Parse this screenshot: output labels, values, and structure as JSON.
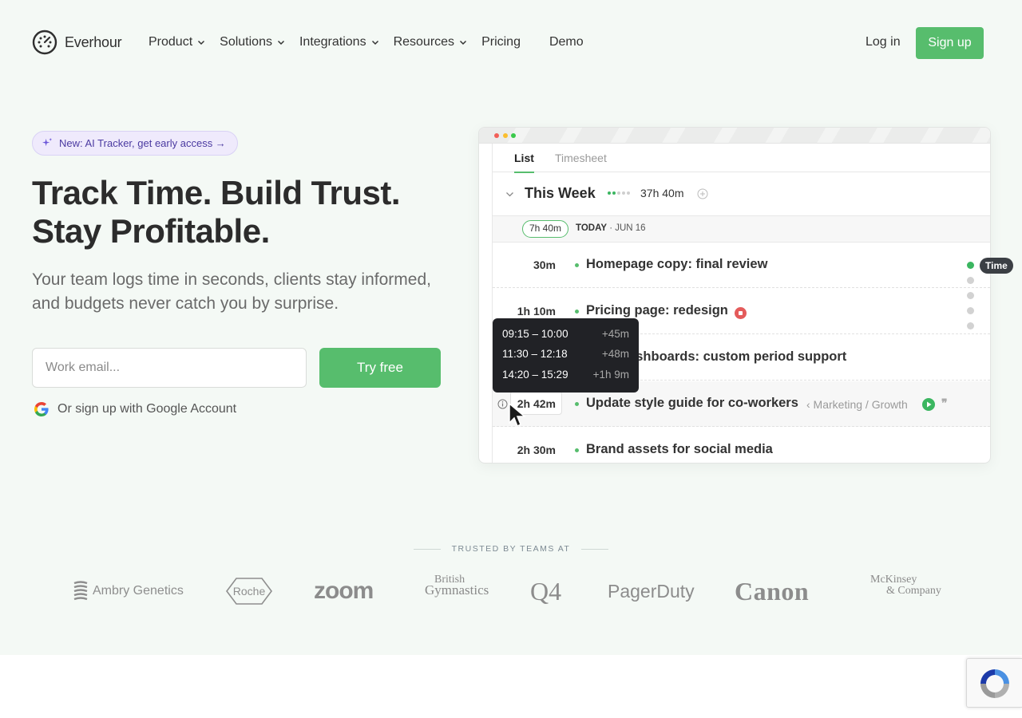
{
  "nav": {
    "brand": "Everhour",
    "items": [
      {
        "label": "Product",
        "dropdown": true
      },
      {
        "label": "Solutions",
        "dropdown": true
      },
      {
        "label": "Integrations",
        "dropdown": true
      },
      {
        "label": "Resources",
        "dropdown": true
      },
      {
        "label": "Pricing",
        "dropdown": false
      },
      {
        "label": "Demo",
        "dropdown": false
      }
    ],
    "login": "Log in",
    "signup": "Sign up"
  },
  "hero": {
    "badge": "New: AI Tracker, get early access →",
    "headline_line1": "Track Time. Build Trust.",
    "headline_line2": "Stay Profitable.",
    "subtitle": "Your team logs time in seconds, clients stay informed, and budgets never catch you by surprise.",
    "email_placeholder": "Work email...",
    "cta": "Try free",
    "google_signup": "Or sign up with Google Account"
  },
  "app": {
    "tabs": [
      {
        "label": "List",
        "active": true
      },
      {
        "label": "Timesheet",
        "active": false
      }
    ],
    "week_title": "This Week",
    "week_total": "37h 40m",
    "day_total": "7h 40m",
    "day_name": "TODAY",
    "day_date": "· JUN 16",
    "entries": [
      {
        "time": "30m",
        "title": "Homepage copy: final review"
      },
      {
        "time": "1h 10m",
        "title": "Pricing page: redesign",
        "running": true
      },
      {
        "time": "",
        "title": "dashboards: custom period support"
      },
      {
        "time": "2h 42m",
        "title": "Update style guide for co-workers",
        "path": "‹ Marketing / Growth"
      },
      {
        "time": "2h 30m",
        "title": "Brand assets for social media"
      }
    ],
    "tooltip": [
      {
        "range": "09:15 – 10:00",
        "delta": "+45m"
      },
      {
        "range": "11:30 – 12:18",
        "delta": "+48m"
      },
      {
        "range": "14:20 – 15:29",
        "delta": "+1h 9m"
      }
    ],
    "rail_label": "Time",
    "quote_glyph": "❞"
  },
  "trusted": {
    "label": "TRUSTED BY TEAMS AT",
    "logos": {
      "ambry": "Ambry Genetics",
      "roche": "Roche",
      "zoom": "zoom",
      "bg_line1": "British",
      "bg_line2": "Gymnastics",
      "q4": "Q4",
      "pagerduty": "PagerDuty",
      "canon": "Canon",
      "mck_line1": "McKinsey",
      "mck_line2": "& Company"
    }
  },
  "colors": {
    "accent": "#57bd6d",
    "badge_bg": "#efeafc",
    "tooltip_bg": "#212226",
    "hero_bg": "#f4f9f5"
  }
}
